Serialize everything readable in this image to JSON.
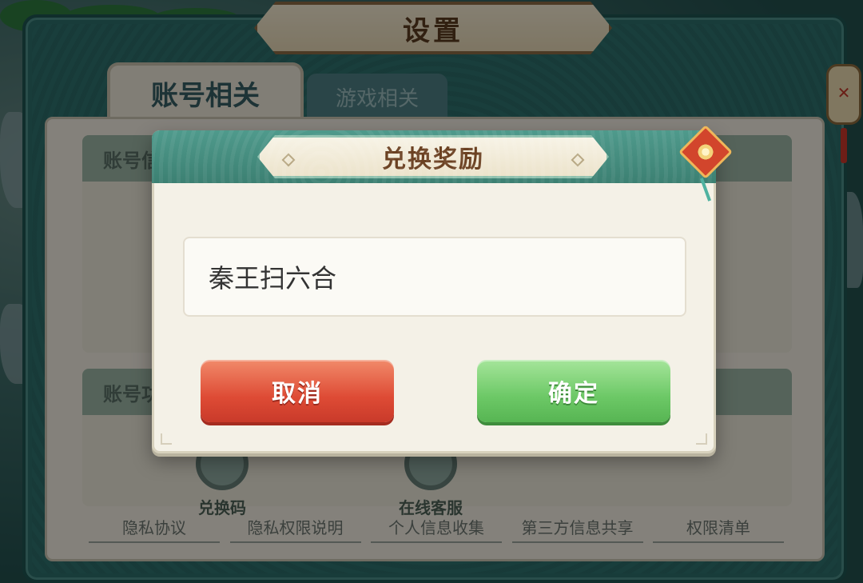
{
  "settings": {
    "title": "设置",
    "tabs": [
      {
        "label": "账号相关",
        "active": true
      },
      {
        "label": "游戏相关",
        "active": false
      }
    ],
    "sections": [
      {
        "label": "账号信"
      },
      {
        "label": "账号功"
      }
    ],
    "services": [
      {
        "label": "兑换码",
        "icon": "redeem-code-icon"
      },
      {
        "label": "在线客服",
        "icon": "customer-service-icon"
      }
    ],
    "links": [
      "隐私协议",
      "隐私权限说明",
      "个人信息收集",
      "第三方信息共享",
      "权限清单"
    ]
  },
  "dialog": {
    "title": "兑换奖励",
    "input_value": "秦王扫六合",
    "cancel_label": "取消",
    "confirm_label": "确定",
    "charm_icon": "lucky-charm-icon"
  },
  "colors": {
    "cancel": "#de4b35",
    "confirm": "#6cc866",
    "header_teal": "#3c8072",
    "title_brown": "#6b4122"
  }
}
